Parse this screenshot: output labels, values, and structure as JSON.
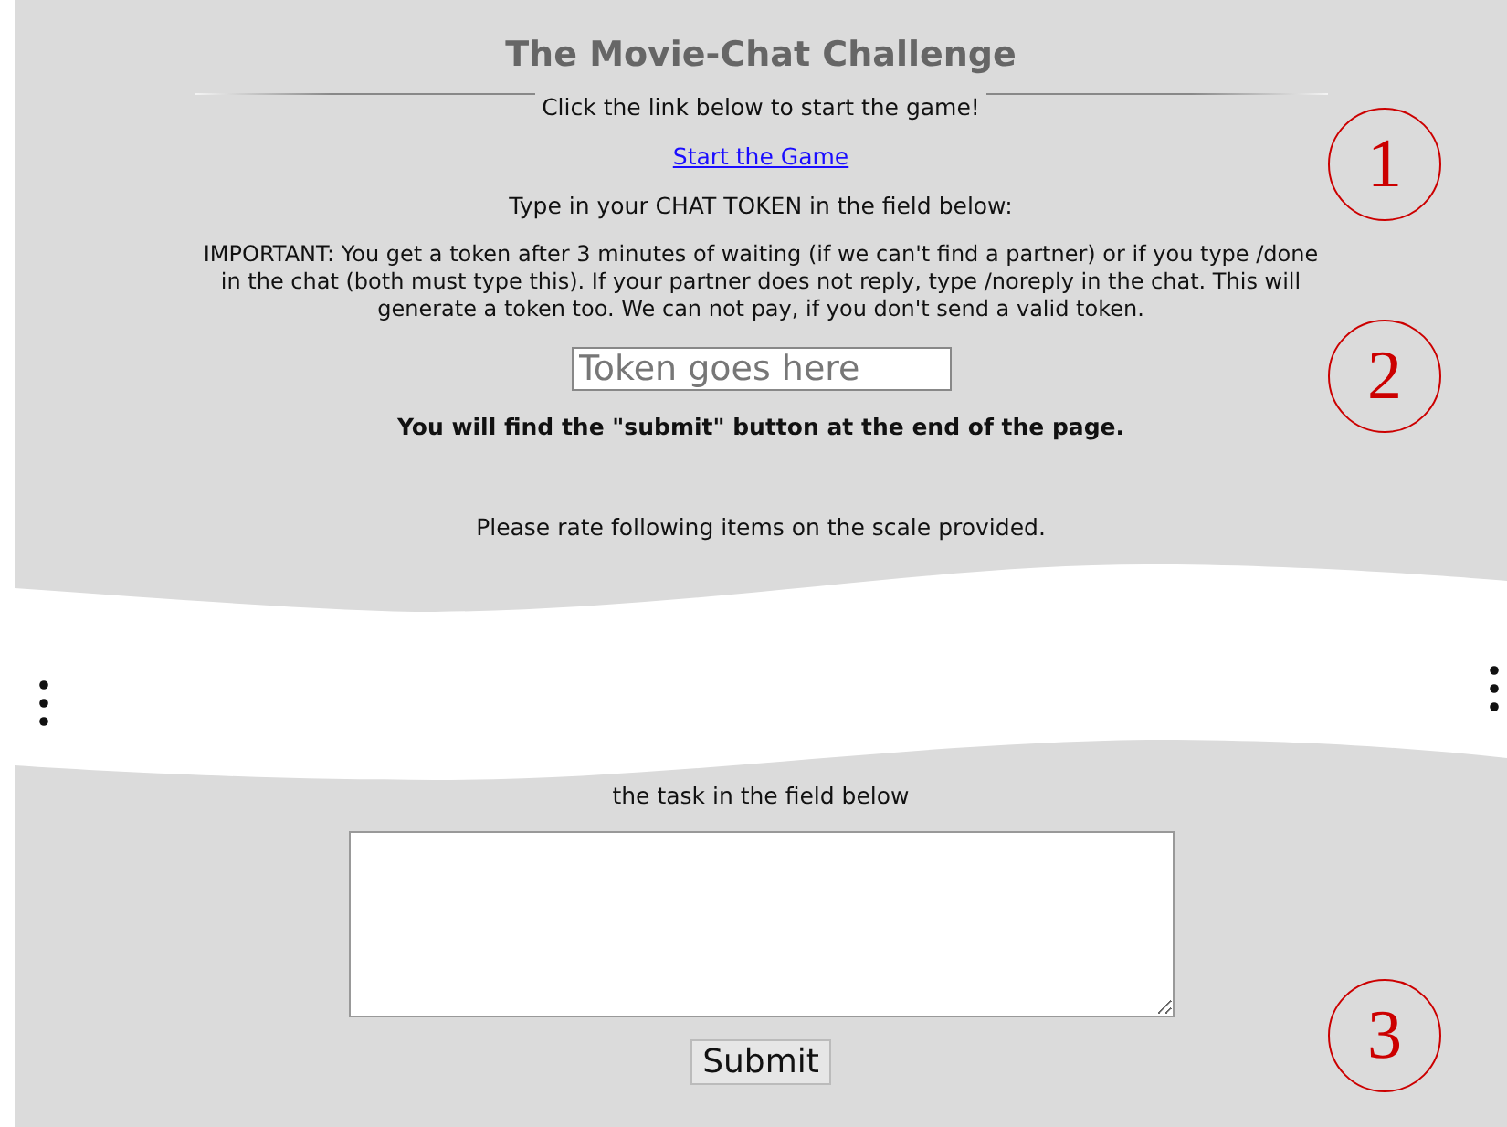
{
  "title": "The Movie-Chat Challenge",
  "intro": "Click the link below to start the game!",
  "start_link": "Start the Game",
  "token_prompt": "Type in your CHAT TOKEN in the field below:",
  "important": "IMPORTANT: You get a token after 3 minutes of waiting (if we can't find a partner) or if you type /done in the chat (both must type this). If your partner does not reply, type /noreply in the chat. This will generate a token too. We can not pay, if you don't send a valid token.",
  "token_field": {
    "placeholder": "Token goes here"
  },
  "submit_note": "You will find the \"submit\" button at the end of the page.",
  "rating_prompt": "Please rate following items on the scale provided.",
  "feedback_prompt": "the task in the field below",
  "submit_button": "Submit",
  "annotations": [
    "1",
    "2",
    "3"
  ]
}
